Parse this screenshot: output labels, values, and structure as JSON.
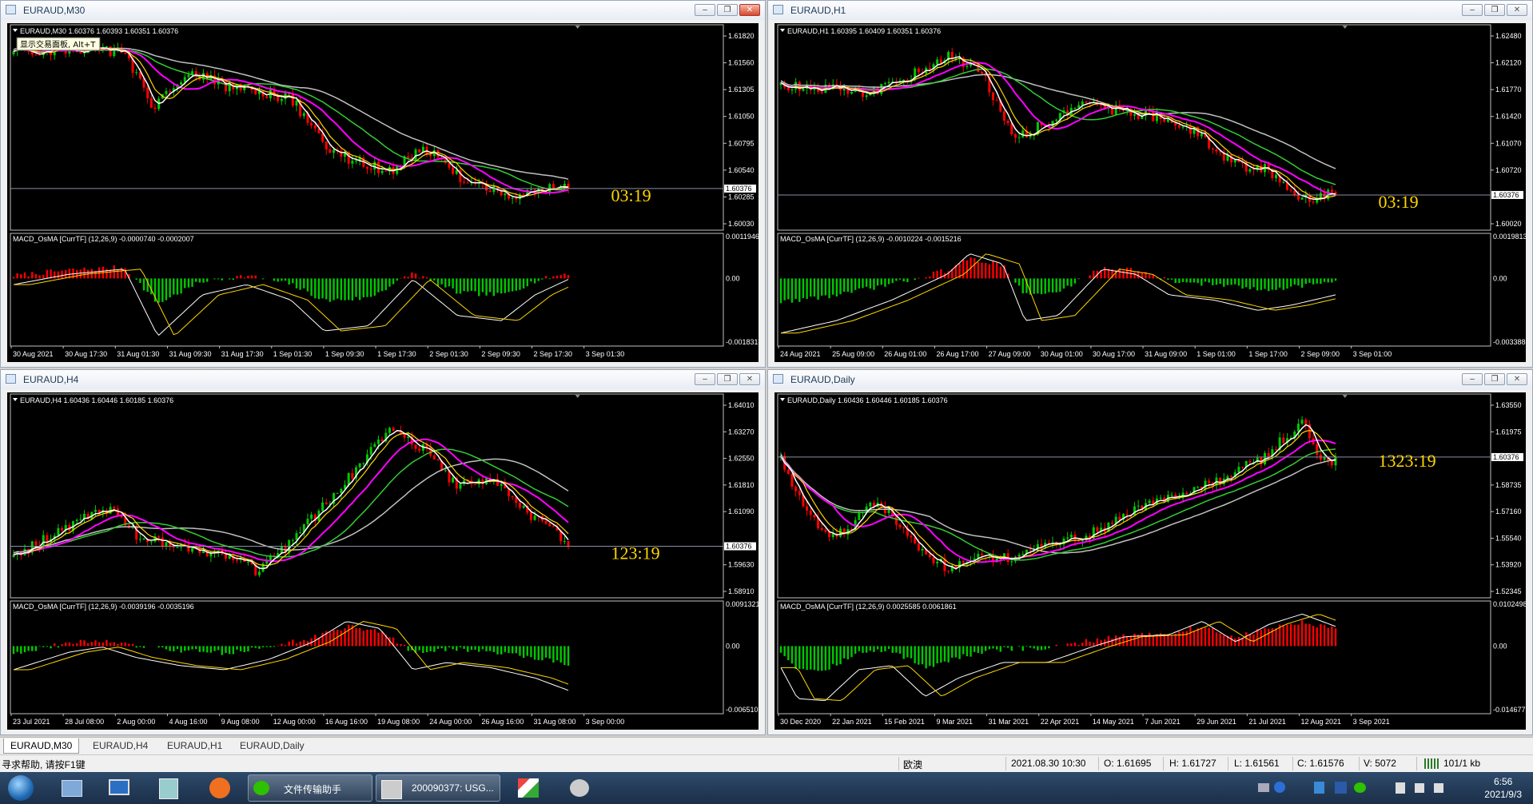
{
  "windows": [
    {
      "title": "EURAUD,M30",
      "info": "EURAUD,M30  1.60376 1.60393 1.60351 1.60376",
      "tooltip": "显示交易面板, Alt+T",
      "macd_label": "MACD_OsMA [CurrTF] (12,26,9) -0.0000740 -0.0002007",
      "timer": "03:19",
      "price_labels": [
        "1.61820",
        "1.61560",
        "1.61305",
        "1.61050",
        "1.60795",
        "1.60540",
        "1.60285",
        "1.60030"
      ],
      "current_price": "1.60376",
      "macd_labels": [
        "0.0011946",
        "0.00",
        "-0.0018318"
      ],
      "time_labels": [
        "30 Aug 2021",
        "30 Aug 17:30",
        "31 Aug 01:30",
        "31 Aug 09:30",
        "31 Aug 17:30",
        "1 Sep 01:30",
        "1 Sep 09:30",
        "1 Sep 17:30",
        "2 Sep 01:30",
        "2 Sep 09:30",
        "2 Sep 17:30",
        "3 Sep 01:30"
      ],
      "close_style": "red"
    },
    {
      "title": "EURAUD,H1",
      "info": "EURAUD,H1  1.60395 1.60409 1.60351 1.60376",
      "tooltip": "",
      "macd_label": "MACD_OsMA [CurrTF] (12,26,9) -0.0010224 -0.0015216",
      "timer": "03:19",
      "price_labels": [
        "1.62480",
        "1.62120",
        "1.61770",
        "1.61420",
        "1.61070",
        "1.60720",
        "1.60376",
        "1.60020"
      ],
      "current_price": "1.60376",
      "macd_labels": [
        "0.0019813",
        "0.00",
        "-0.0033888"
      ],
      "time_labels": [
        "24 Aug 2021",
        "25 Aug 09:00",
        "26 Aug 01:00",
        "26 Aug 17:00",
        "27 Aug 09:00",
        "30 Aug 01:00",
        "30 Aug 17:00",
        "31 Aug 09:00",
        "1 Sep 01:00",
        "1 Sep 17:00",
        "2 Sep 09:00",
        "3 Sep 01:00"
      ],
      "close_style": "gray"
    },
    {
      "title": "EURAUD,H4",
      "info": "EURAUD,H4  1.60436 1.60446 1.60185 1.60376",
      "tooltip": "",
      "macd_label": "MACD_OsMA [CurrTF] (12,26,9) -0.0039196 -0.0035196",
      "timer": "123:19",
      "price_labels": [
        "1.64010",
        "1.63270",
        "1.62550",
        "1.61810",
        "1.61090",
        "1.60376",
        "1.59630",
        "1.58910"
      ],
      "current_price": "1.60376",
      "macd_labels": [
        "0.0091321",
        "0.00",
        "-0.006510"
      ],
      "time_labels": [
        "23 Jul 2021",
        "28 Jul 08:00",
        "2 Aug 00:00",
        "4 Aug 16:00",
        "9 Aug 08:00",
        "12 Aug 00:00",
        "16 Aug 16:00",
        "19 Aug 08:00",
        "24 Aug 00:00",
        "26 Aug 16:00",
        "31 Aug 08:00",
        "3 Sep 00:00"
      ],
      "close_style": "gray"
    },
    {
      "title": "EURAUD,Daily",
      "info": "EURAUD,Daily  1.60436 1.60446 1.60185 1.60376",
      "tooltip": "",
      "macd_label": "MACD_OsMA [CurrTF] (12,26,9) 0.0025585 0.0061861",
      "timer": "1323:19",
      "price_labels": [
        "1.63550",
        "1.61975",
        "1.60376",
        "1.58735",
        "1.57160",
        "1.55540",
        "1.53920",
        "1.52345"
      ],
      "current_price": "1.60376",
      "macd_labels": [
        "0.0102498",
        "0.00",
        "-0.0146771"
      ],
      "time_labels": [
        "30 Dec 2020",
        "22 Jan 2021",
        "15 Feb 2021",
        "9 Mar 2021",
        "31 Mar 2021",
        "22 Apr 2021",
        "14 May 2021",
        "7 Jun 2021",
        "29 Jun 2021",
        "21 Jul 2021",
        "12 Aug 2021",
        "3 Sep 2021"
      ],
      "close_style": "gray"
    }
  ],
  "tabs": [
    "EURAUD,M30",
    "EURAUD,H4",
    "EURAUD,H1",
    "EURAUD,Daily"
  ],
  "status": {
    "help": "寻求帮助, 请按F1键",
    "profile": "欧澳",
    "datetime": "2021.08.30 10:30",
    "open": "O: 1.61695",
    "high": "H: 1.61727",
    "low": "L: 1.61561",
    "close": "C: 1.61576",
    "volume": "V: 5072",
    "traffic": "101/1 kb"
  },
  "taskbar": {
    "wechat_label": "文件传输助手",
    "mt_label": "200090377: USG...",
    "time": "6:56",
    "date": "2021/9/3"
  },
  "colors": {
    "bull": "#00c800",
    "bear": "#ff0000",
    "ma_fast": "#ffffff",
    "ma_yellow": "#ffd700",
    "ma_magenta": "#ff00ff",
    "ma_green": "#32cd32",
    "ma_gray": "#c0c0c0",
    "timer": "#ffd700"
  },
  "chart_data": [
    {
      "type": "candlestick",
      "title": "EURAUD,M30",
      "series": [
        {
          "name": "EURAUD,M30",
          "close_last": 1.60376
        }
      ],
      "ylim": [
        1.6003,
        1.6208
      ]
    },
    {
      "type": "candlestick",
      "title": "EURAUD,H1",
      "series": [
        {
          "name": "EURAUD,H1",
          "close_last": 1.60376
        }
      ],
      "ylim": [
        1.6002,
        1.6265
      ]
    },
    {
      "type": "candlestick",
      "title": "EURAUD,H4",
      "series": [
        {
          "name": "EURAUD,H4",
          "close_last": 1.60376
        }
      ],
      "ylim": [
        1.5891,
        1.6445
      ]
    },
    {
      "type": "candlestick",
      "title": "EURAUD,Daily",
      "series": [
        {
          "name": "EURAUD,Daily",
          "close_last": 1.60376
        }
      ],
      "ylim": [
        1.5234,
        1.6395
      ]
    }
  ]
}
